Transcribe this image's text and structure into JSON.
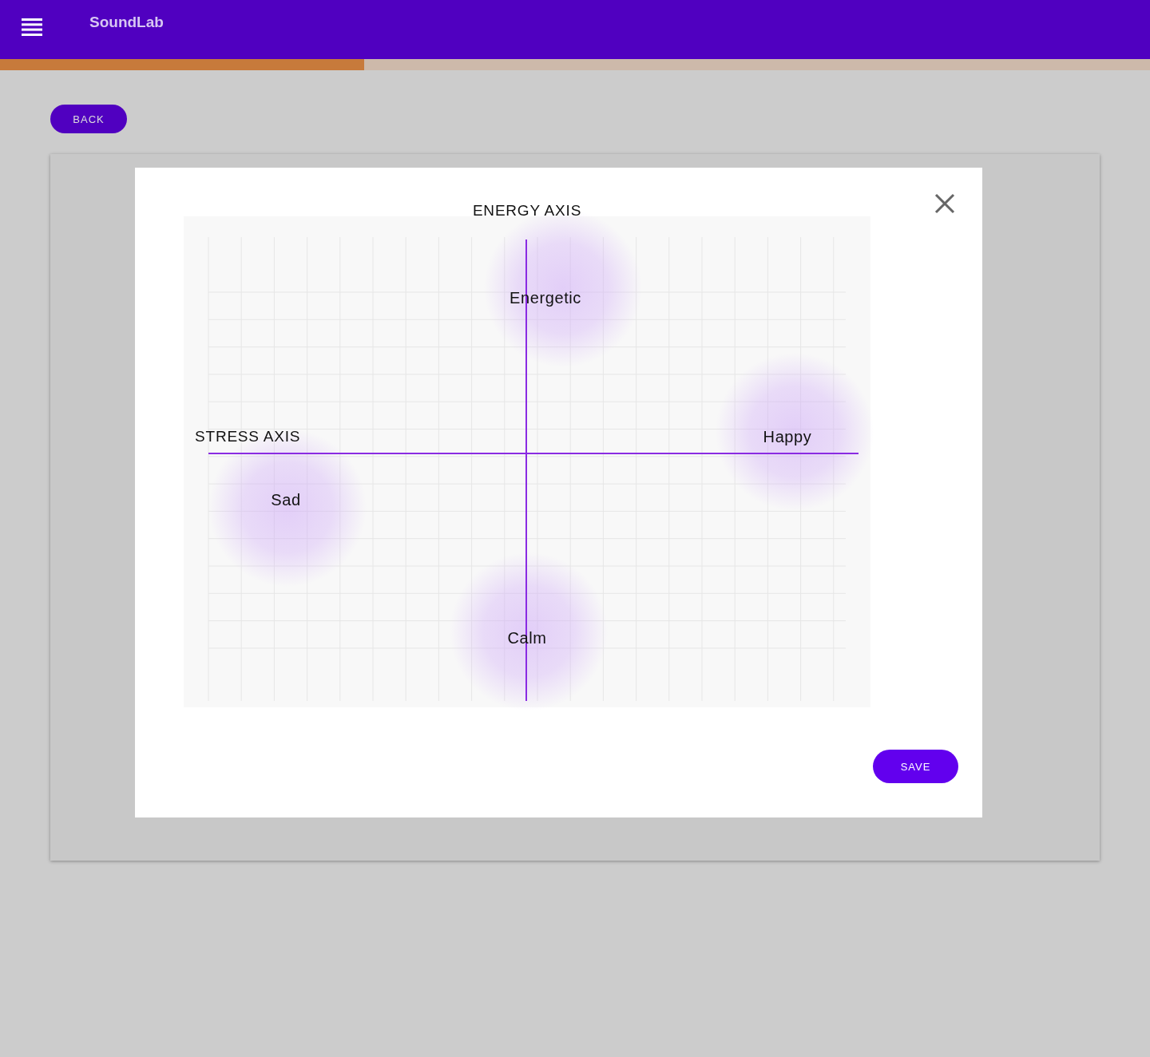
{
  "app": {
    "title": "SoundLab"
  },
  "progress": {
    "level": 0.317
  },
  "back_button": "BACK",
  "dialog": {
    "y_axis_label": "ENERGY AXIS",
    "x_axis_label": "STRESS AXIS",
    "moods": [
      {
        "label": "Energetic"
      },
      {
        "label": "Happy"
      },
      {
        "label": "Sad"
      },
      {
        "label": "Calm"
      }
    ],
    "save_button": "SAVE"
  }
}
